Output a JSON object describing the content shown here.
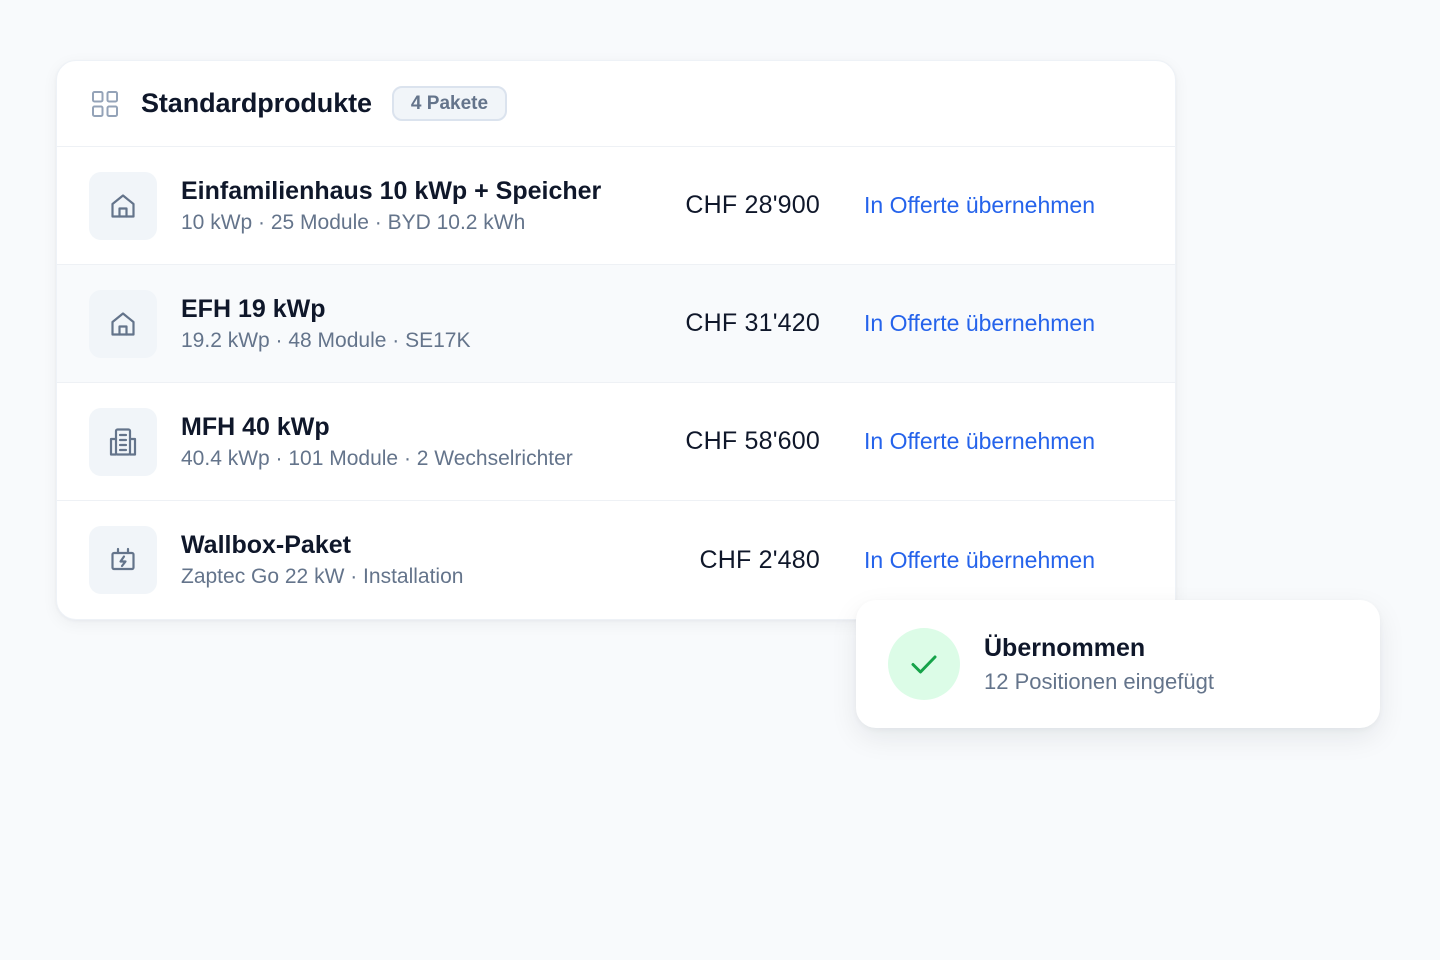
{
  "card": {
    "title": "Standardprodukte",
    "badge": "4 Pakete",
    "rows": [
      {
        "icon": "house-icon",
        "name": "Einfamilienhaus 10 kWp + Speicher",
        "meta": "10 kWp · 25 Module · BYD 10.2 kWh",
        "price": "CHF 28'900",
        "action": "In Offerte übernehmen"
      },
      {
        "icon": "house-icon",
        "name": "EFH 19 kWp",
        "meta": "19.2 kWp · 48 Module · SE17K",
        "price": "CHF 31'420",
        "action": "In Offerte übernehmen"
      },
      {
        "icon": "building-icon",
        "name": "MFH 40 kWp",
        "meta": "40.4 kWp · 101 Module · 2 Wechselrichter",
        "price": "CHF 58'600",
        "action": "In Offerte übernehmen"
      },
      {
        "icon": "ev-charger-icon",
        "name": "Wallbox-Paket",
        "meta": "Zaptec Go 22 kW · Installation",
        "price": "CHF 2'480",
        "action": "In Offerte übernehmen"
      }
    ]
  },
  "toast": {
    "title": "Übernommen",
    "subtitle": "12 Positionen eingefügt"
  },
  "colors": {
    "background": "#f8fafc",
    "accent": "#2563eb",
    "success": "#16a34a",
    "success_bg": "#dcfce7",
    "muted_text": "#64748b",
    "icon_tile": "#f1f5f9"
  }
}
